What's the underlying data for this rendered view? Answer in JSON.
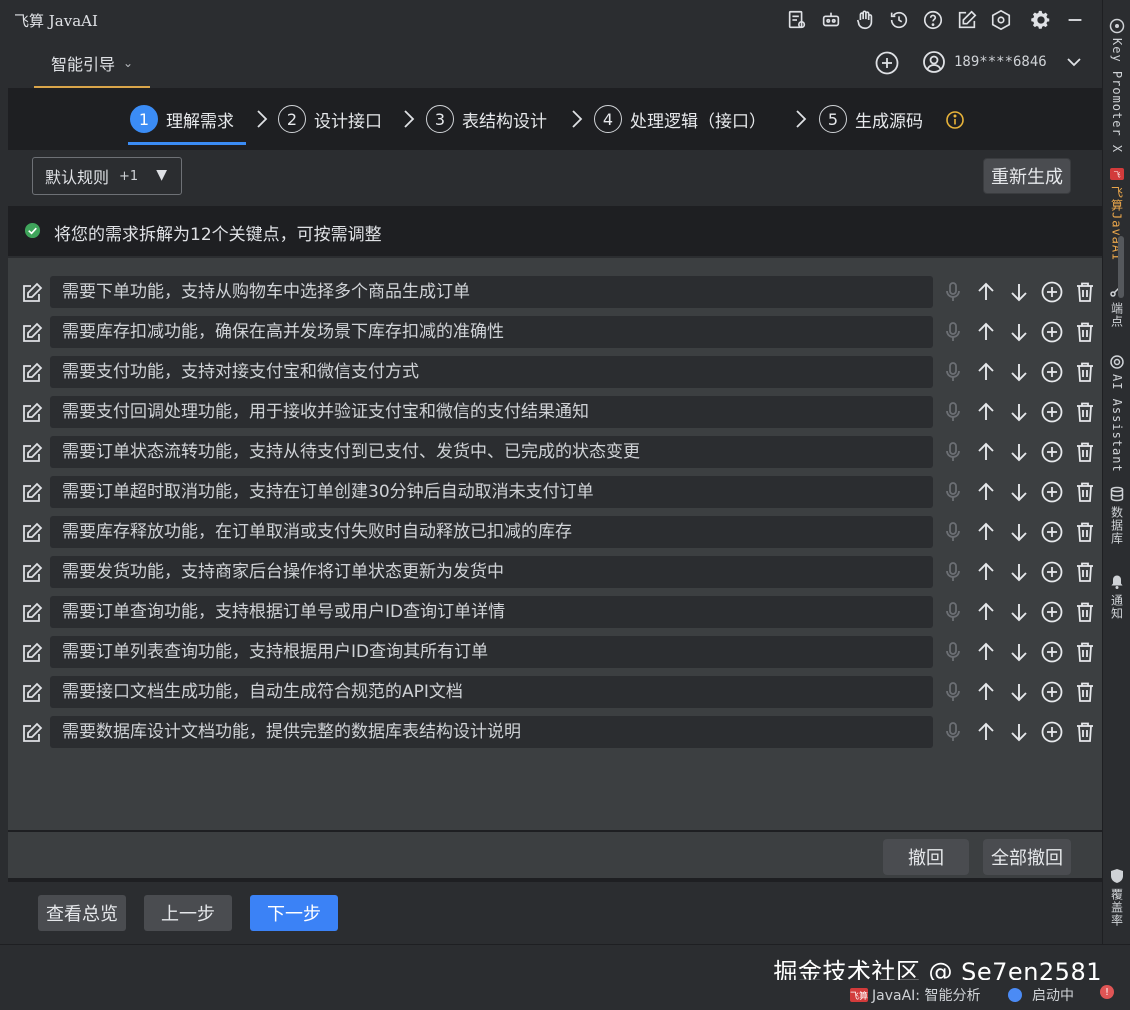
{
  "app": {
    "title": "飞算 JavaAI"
  },
  "header": {
    "guide_label": "智能引导",
    "user_phone": "189****6846"
  },
  "steps": [
    {
      "num": "1",
      "label": "理解需求",
      "active": true
    },
    {
      "num": "2",
      "label": "设计接口",
      "active": false
    },
    {
      "num": "3",
      "label": "表结构设计",
      "active": false
    },
    {
      "num": "4",
      "label": "处理逻辑（接口）",
      "active": false
    },
    {
      "num": "5",
      "label": "生成源码",
      "active": false
    }
  ],
  "rules": {
    "select_value": "默认规则",
    "select_extra": "+1",
    "regenerate_label": "重新生成"
  },
  "info": {
    "text": "将您的需求拆解为12个关键点，可按需调整"
  },
  "requirements": [
    "需要下单功能，支持从购物车中选择多个商品生成订单",
    "需要库存扣减功能，确保在高并发场景下库存扣减的准确性",
    "需要支付功能，支持对接支付宝和微信支付方式",
    "需要支付回调处理功能，用于接收并验证支付宝和微信的支付结果通知",
    "需要订单状态流转功能，支持从待支付到已支付、发货中、已完成的状态变更",
    "需要订单超时取消功能，支持在订单创建30分钟后自动取消未支付订单",
    "需要库存释放功能，在订单取消或支付失败时自动释放已扣减的库存",
    "需要发货功能，支持商家后台操作将订单状态更新为发货中",
    "需要订单查询功能，支持根据订单号或用户ID查询订单详情",
    "需要订单列表查询功能，支持根据用户ID查询其所有订单",
    "需要接口文档生成功能，自动生成符合规范的API文档",
    "需要数据库设计文档功能，提供完整的数据库表结构设计说明"
  ],
  "undo": {
    "undo_label": "撤回",
    "undo_all_label": "全部撤回"
  },
  "bottom": {
    "overview_label": "查看总览",
    "prev_label": "上一步",
    "next_label": "下一步"
  },
  "watermark": "掘金技术社区 @ Se7en2581",
  "status": {
    "logo_text": "飞算",
    "analysis": "JavaAI: 智能分析",
    "starting": "启动中"
  },
  "sidebar": [
    {
      "icon": "key-promoter-icon",
      "label": "Key Promoter X",
      "active": false
    },
    {
      "icon": "javaai-logo-icon",
      "label": "飞算JavaAI",
      "active": true
    },
    {
      "icon": "endpoint-icon",
      "label": "端点",
      "active": false
    },
    {
      "icon": "ai-assistant-icon",
      "label": "AI Assistant",
      "active": false
    },
    {
      "icon": "database-icon",
      "label": "数据库",
      "active": false
    },
    {
      "icon": "bell-icon",
      "label": "通知",
      "active": false
    },
    {
      "icon": "shield-icon",
      "label": "覆盖率",
      "active": false
    }
  ],
  "colors": {
    "accent": "#3b8cf5",
    "tab_underline": "#d9a54a",
    "success": "#3fa45b"
  }
}
